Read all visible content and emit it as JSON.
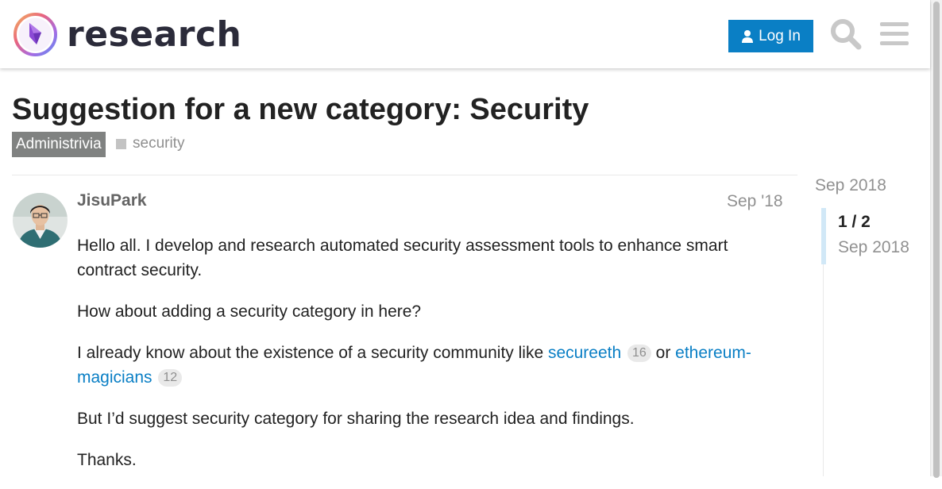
{
  "header": {
    "site_name": "research",
    "login_label": "Log In",
    "login_icon": "user-icon",
    "search_icon": "search-icon",
    "menu_icon": "hamburger-menu-icon"
  },
  "topic": {
    "title": "Suggestion for a new category: Security",
    "category": "Administrivia",
    "tag": "security"
  },
  "post": {
    "username": "JisuPark",
    "date": "Sep '18",
    "paragraphs": {
      "p1": "Hello all. I develop and research automated security assessment tools to enhance smart contract security.",
      "p2": "How about adding a security category in here?",
      "p3_prefix": "I already know about the existence of a security community like ",
      "link1_text": "secureeth",
      "link1_count": "16",
      "p3_mid": " or ",
      "link2_text": "ethereum-magicians",
      "link2_count": "12",
      "p4": "But I’d suggest security category for sharing the research idea and findings.",
      "p5": "Thanks."
    }
  },
  "timeline": {
    "start_date": "Sep 2018",
    "position": "1 / 2",
    "current_date": "Sep 2018"
  },
  "colors": {
    "accent": "#0a7fc5",
    "category_bg": "#808281",
    "muted_text": "#919191"
  }
}
